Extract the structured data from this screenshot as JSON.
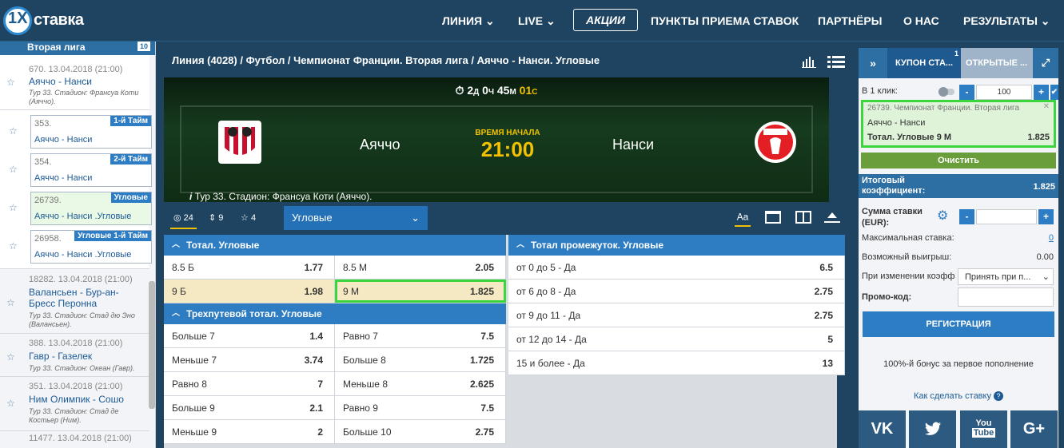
{
  "logo": {
    "one": "1X",
    "name": "ставка"
  },
  "nav": {
    "liniya": "ЛИНИЯ",
    "live": "LIVE",
    "akcii": "АКЦИИ",
    "punkty": "ПУНКТЫ ПРИЕМА СТАВОК",
    "partnery": "ПАРТНЁРЫ",
    "o_nas": "О НАС",
    "rezultaty": "РЕЗУЛЬТАТЫ"
  },
  "sidebar": {
    "header": "Вторая лига",
    "header_badge": "10",
    "matches": [
      {
        "date": "670. 13.04.2018 (21:00)",
        "teams": "Аяччо - Нанси",
        "info": "Тур 33. Стадион: Франсуа Коти (Аяччо)."
      },
      {
        "date": "18282. 13.04.2018 (21:00)",
        "teams": "Валансьен - Бур-ан-Бресс Перонна",
        "info": "Тур 33. Стадион: Стад дю Эно (Валансьен)."
      },
      {
        "date": "388. 13.04.2018 (21:00)",
        "teams": "Гавр - Газелек",
        "info": "Тур 33. Стадион: Океан (Гавр)."
      },
      {
        "date": "351. 13.04.2018 (21:00)",
        "teams": "Ним Олимпик - Сошо",
        "info": "Тур 33. Стадион: Стад де Костьер (Ним)."
      },
      {
        "date": "11477. 13.04.2018 (21:00)"
      }
    ],
    "subs": [
      {
        "num": "353.",
        "teams": "Аяччо - Нанси",
        "tag": "1-й Тайм"
      },
      {
        "num": "354.",
        "teams": "Аяччо - Нанси",
        "tag": "2-й Тайм"
      },
      {
        "num": "26739.",
        "teams": "Аяччо - Нанси .Угловые",
        "tag": "Угловые"
      },
      {
        "num": "26958.",
        "teams": "Аяччо - Нанси .Угловые",
        "tag": "Угловые 1-й Тайм"
      }
    ]
  },
  "breadcrumb": "Линия (4028)  /  Футбол  /  Чемпионат Франции. Вторая лига  /  Аяччо - Нанси. Угловые",
  "hero": {
    "timer_days": "2",
    "timer_d": "Д",
    "timer_h": "0",
    "timer_hl": "Ч",
    "timer_m": "45",
    "timer_ml": "М",
    "timer_s": "01",
    "timer_sl": "С",
    "team1": "Аяччо",
    "team2": "Нанси",
    "start_label": "ВРЕМЯ НАЧАЛА",
    "start_time": "21:00",
    "stadium": "Тур 33. Стадион: Франсуа Коти (Аяччо)."
  },
  "tabs": {
    "count1": "24",
    "count2": "9",
    "count3": "4",
    "select": "Угловые"
  },
  "markets": {
    "left": [
      {
        "title": "Тотал. Угловые",
        "rows": [
          [
            "8.5 Б",
            "1.77",
            "8.5 М",
            "2.05"
          ],
          [
            "9 Б",
            "1.98",
            "9 М",
            "1.825"
          ]
        ]
      },
      {
        "title": "Трехпутевой тотал. Угловые",
        "rows": [
          [
            "Больше 7",
            "1.4",
            "Равно 7",
            "7.5"
          ],
          [
            "Меньше 7",
            "3.74",
            "Больше 8",
            "1.725"
          ],
          [
            "Равно 8",
            "7",
            "Меньше 8",
            "2.625"
          ],
          [
            "Больше 9",
            "2.1",
            "Равно 9",
            "7.5"
          ],
          [
            "Меньше 9",
            "2",
            "Больше 10",
            "2.75"
          ]
        ]
      }
    ],
    "right": {
      "title": "Тотал промежуток. Угловые",
      "rows": [
        [
          "от 0 до 5 - Да",
          "6.5"
        ],
        [
          "от 6 до 8 - Да",
          "2.75"
        ],
        [
          "от 9 до 11 - Да",
          "2.75"
        ],
        [
          "от 12 до 14 - Да",
          "5"
        ],
        [
          "15 и более - Да",
          "13"
        ]
      ]
    }
  },
  "coupon": {
    "tab1": "КУПОН СТА...",
    "tab1_badge": "1",
    "tab2": "ОТКРЫТЫЕ ...",
    "one_click": "В 1 клик:",
    "one_click_value": "100",
    "bet_league": "26739. Чемпионат Франции. Вторая лига",
    "bet_match": "Аяччо - Нанси",
    "bet_market": "Тотал. Угловые 9 М",
    "bet_odds": "1.825",
    "clear": "Очистить",
    "total_label": "Итоговый коэффициент:",
    "total_value": "1.825",
    "stake_label": "Сумма ставки (EUR):",
    "max_label": "Максимальная ставка:",
    "max_value": "0",
    "win_label": "Возможный выигрыш:",
    "win_value": "0.00",
    "change_label": "При изменении коэфф",
    "change_select": "Принять при п...",
    "promo_label": "Промо-код:",
    "register": "РЕГИСТРАЦИЯ",
    "bonus": "100%-й бонус за первое пополнение",
    "howto": "Как сделать ставку"
  },
  "social": {
    "vk": "VK",
    "youtube_top": "You",
    "youtube_bottom": "Tube",
    "gplus": "G+"
  }
}
